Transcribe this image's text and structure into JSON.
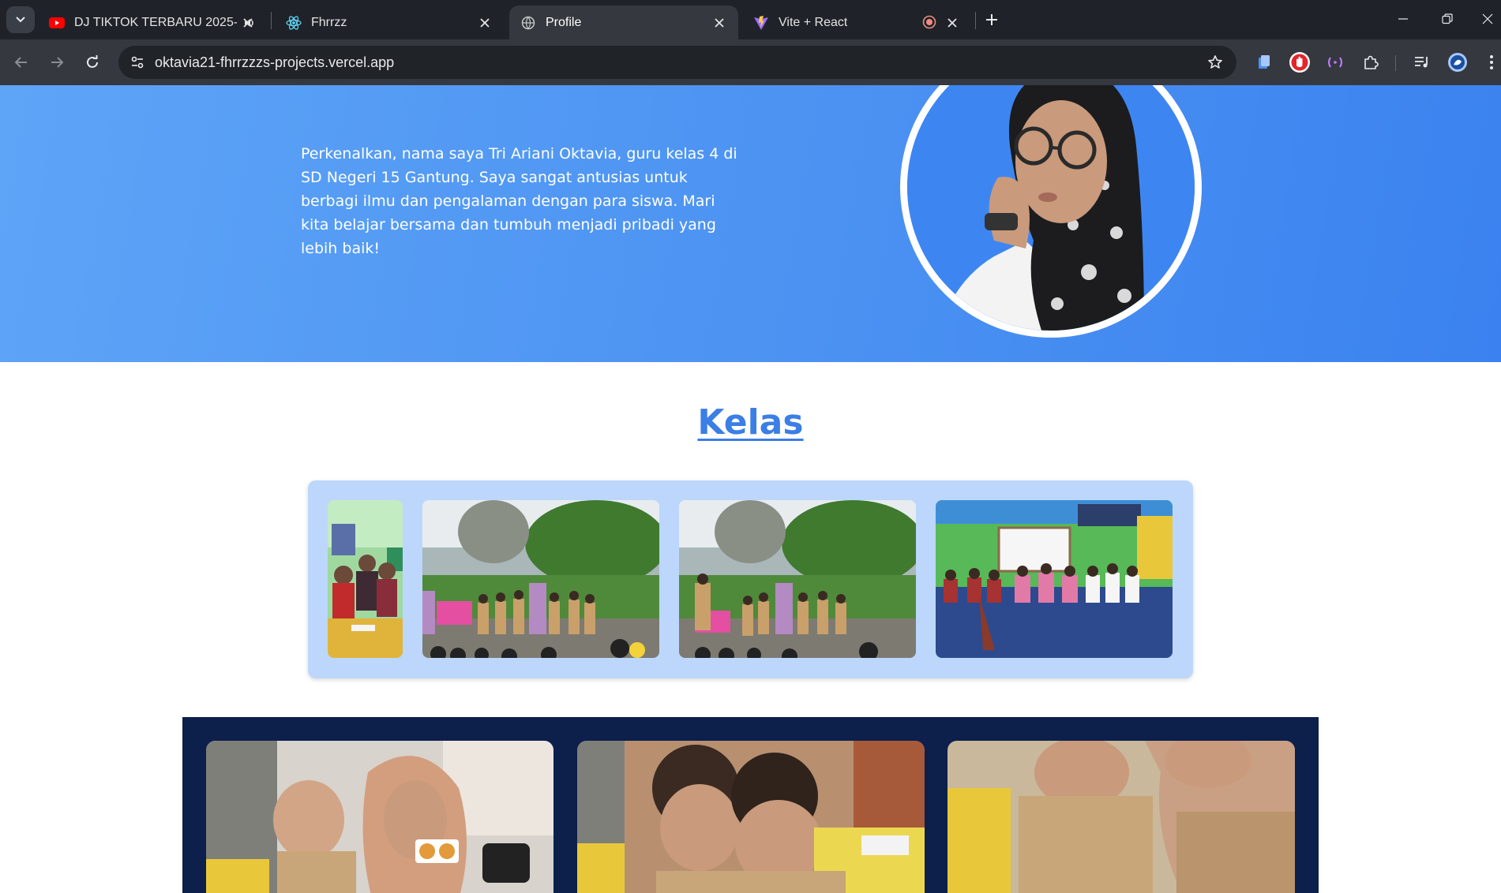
{
  "browser": {
    "tabs": [
      {
        "title": "DJ TIKTOK TERBARU 2025- ♪",
        "icon": "youtube-icon",
        "audible": true,
        "active": false
      },
      {
        "title": "Fhrrzz",
        "icon": "react-icon",
        "active": false
      },
      {
        "title": "Profile",
        "icon": "globe-icon",
        "active": true
      },
      {
        "title": "Vite + React",
        "icon": "vite-icon",
        "recording": true,
        "active": false
      }
    ],
    "address": "oktavia21-fhrrzzzs-projects.vercel.app"
  },
  "page": {
    "hero": {
      "intro": "Perkenalkan, nama saya Tri Ariani Oktavia, guru kelas 4 di SD Negeri 15 Gantung. Saya sangat antusias untuk berbagi ilmu dan pengalaman dengan para siswa. Mari kita belajar bersama dan tumbuh menjadi pribadi yang lebih baik!"
    },
    "kelas": {
      "title": "Kelas"
    },
    "colors": {
      "hero": "#4b92f2",
      "title": "#3b7ee6",
      "gallery_bg": "#bcd7fb",
      "dark_section": "#0d1f4b"
    }
  }
}
